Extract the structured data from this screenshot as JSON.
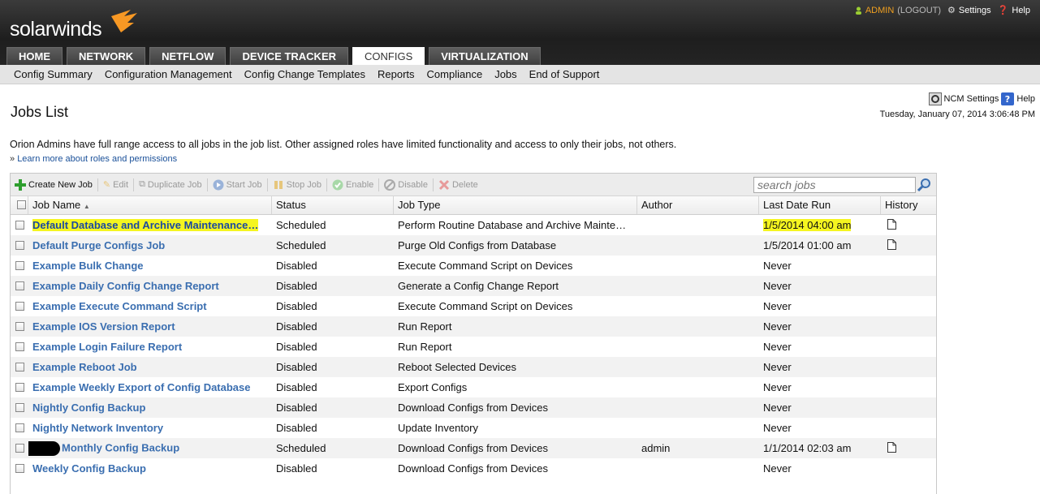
{
  "brand": {
    "name": "solarwinds",
    "accent": "#f79824"
  },
  "user_bar": {
    "user": "ADMIN",
    "logout": "(LOGOUT)",
    "settings": "Settings",
    "help": "Help"
  },
  "tabs": [
    {
      "label": "HOME",
      "active": false
    },
    {
      "label": "NETWORK",
      "active": false
    },
    {
      "label": "NETFLOW",
      "active": false
    },
    {
      "label": "DEVICE TRACKER",
      "active": false
    },
    {
      "label": "CONFIGS",
      "active": true
    },
    {
      "label": "VIRTUALIZATION",
      "active": false
    }
  ],
  "subnav": [
    "Config Summary",
    "Configuration Management",
    "Config Change Templates",
    "Reports",
    "Compliance",
    "Jobs",
    "End of Support"
  ],
  "page": {
    "title": "Jobs List",
    "ncm_settings": "NCM Settings",
    "help": "Help",
    "date": "Tuesday, January 07, 2014 3:06:48 PM",
    "note": "Orion Admins have full range access to all jobs in the job list. Other assigned roles have limited functionality and access to only their jobs, not others.",
    "learn_prefix": "»",
    "learn_link": "Learn more about roles and permissions"
  },
  "toolbar": {
    "create": "Create New Job",
    "edit": "Edit",
    "duplicate": "Duplicate Job",
    "start": "Start Job",
    "stop": "Stop Job",
    "enable": "Enable",
    "disable": "Disable",
    "delete": "Delete",
    "search_placeholder": "search jobs"
  },
  "columns": [
    "Job Name",
    "Status",
    "Job Type",
    "Author",
    "Last Date Run",
    "History"
  ],
  "jobs": [
    {
      "name": "Default Database and Archive Maintenance…",
      "status": "Scheduled",
      "type": "Perform Routine Database and Archive Mainte…",
      "author": "",
      "last_run": "1/5/2014 04:00 am",
      "history": true,
      "highlight": true
    },
    {
      "name": "Default Purge Configs Job",
      "status": "Scheduled",
      "type": "Purge Old Configs from Database",
      "author": "",
      "last_run": "1/5/2014 01:00 am",
      "history": true
    },
    {
      "name": "Example Bulk Change",
      "status": "Disabled",
      "type": "Execute Command Script on Devices",
      "author": "",
      "last_run": "Never",
      "history": false
    },
    {
      "name": "Example Daily Config Change Report",
      "status": "Disabled",
      "type": "Generate a Config Change Report",
      "author": "",
      "last_run": "Never",
      "history": false
    },
    {
      "name": "Example Execute Command Script",
      "status": "Disabled",
      "type": "Execute Command Script on Devices",
      "author": "",
      "last_run": "Never",
      "history": false
    },
    {
      "name": "Example IOS Version Report",
      "status": "Disabled",
      "type": "Run Report",
      "author": "",
      "last_run": "Never",
      "history": false
    },
    {
      "name": "Example Login Failure Report",
      "status": "Disabled",
      "type": "Run Report",
      "author": "",
      "last_run": "Never",
      "history": false
    },
    {
      "name": "Example Reboot Job",
      "status": "Disabled",
      "type": "Reboot Selected Devices",
      "author": "",
      "last_run": "Never",
      "history": false
    },
    {
      "name": "Example Weekly Export of Config Database",
      "status": "Disabled",
      "type": "Export Configs",
      "author": "",
      "last_run": "Never",
      "history": false
    },
    {
      "name": "Nightly Config Backup",
      "status": "Disabled",
      "type": "Download Configs from Devices",
      "author": "",
      "last_run": "Never",
      "history": false
    },
    {
      "name": "Nightly Network Inventory",
      "status": "Disabled",
      "type": "Update Inventory",
      "author": "",
      "last_run": "Never",
      "history": false
    },
    {
      "name": "Monthly Config Backup",
      "status": "Scheduled",
      "type": "Download Configs from Devices",
      "author": "admin",
      "last_run": "1/1/2014 02:03 am",
      "history": true,
      "redacted_prefix": true
    },
    {
      "name": "Weekly Config Backup",
      "status": "Disabled",
      "type": "Download Configs from Devices",
      "author": "",
      "last_run": "Never",
      "history": false
    }
  ]
}
